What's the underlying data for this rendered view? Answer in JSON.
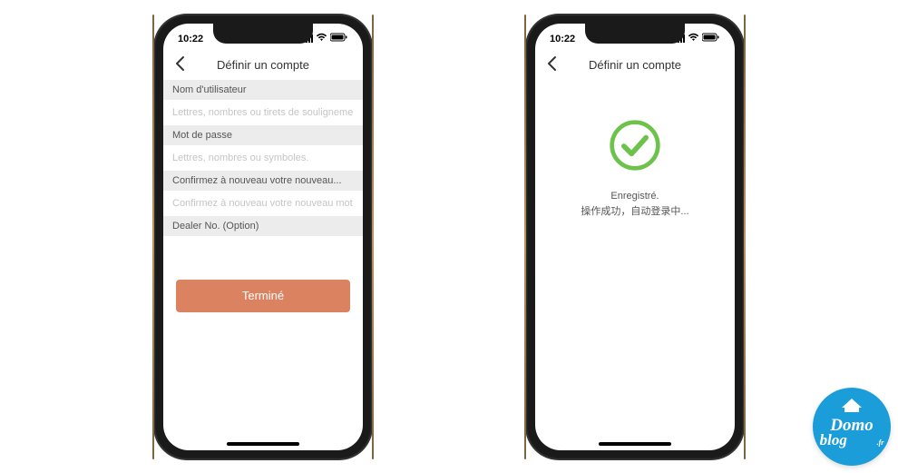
{
  "status": {
    "time": "10:22"
  },
  "left": {
    "nav_title": "Définir un compte",
    "username_label": "Nom d'utilisateur",
    "username_placeholder": "Lettres, nombres ou tirets de soulignement.",
    "password_label": "Mot de passe",
    "password_placeholder": "Lettres, nombres ou symboles.",
    "confirm_label": "Confirmez à nouveau votre nouveau...",
    "confirm_placeholder": "Confirmez à nouveau votre nouveau mot de...",
    "dealer_label": "Dealer No. (Option)",
    "submit_label": "Terminé"
  },
  "right": {
    "nav_title": "Définir un compte",
    "success_line1": "Enregistré.",
    "success_line2": "操作成功，自动登录中..."
  },
  "logo": {
    "line1": "Domo",
    "line2": "blog",
    "suffix": ".fr"
  },
  "colors": {
    "accent_button": "#db8260",
    "success_green": "#6cc24a",
    "badge_blue": "#1b9dd9"
  }
}
